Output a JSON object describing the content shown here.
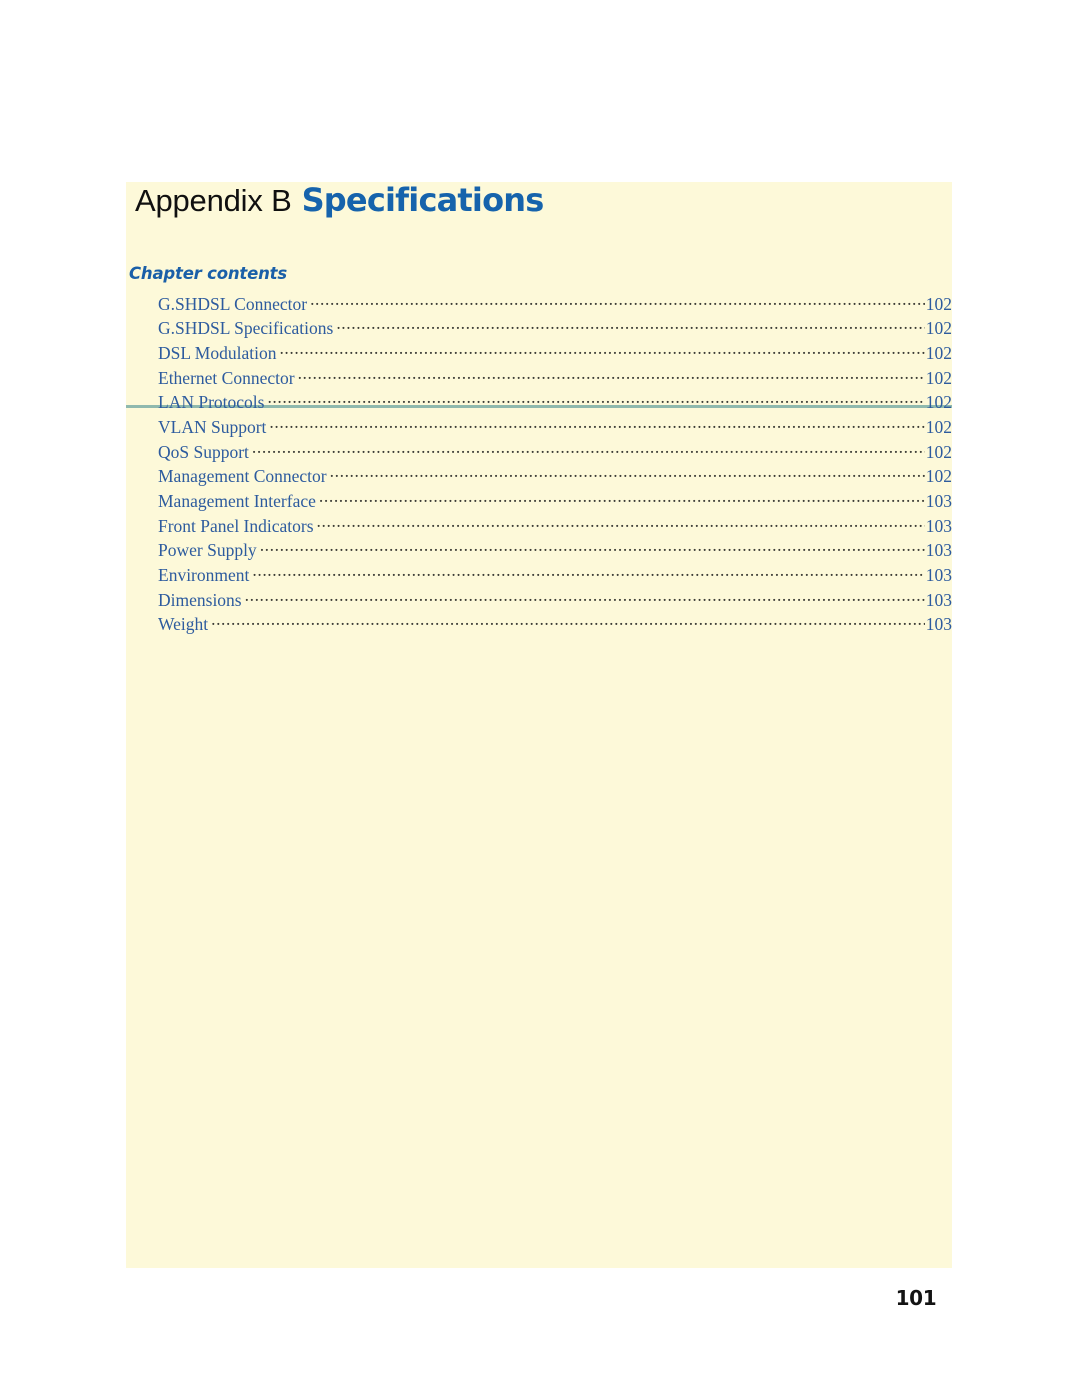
{
  "page": {
    "folio": "101",
    "background_color": "#ffffff",
    "panel_color": "#fdf9d9",
    "rule_color": "#8fb9ae",
    "accent_blue": "#1663ac",
    "toc_text_color": "#2d5b9e"
  },
  "header": {
    "appendix_label": "Appendix B",
    "chapter_name": "Specifications"
  },
  "contents": {
    "heading": "Chapter contents",
    "entries": [
      {
        "label": "G.SHDSL Connector",
        "page": "102"
      },
      {
        "label": "G.SHDSL Specifications",
        "page": "102"
      },
      {
        "label": "DSL Modulation",
        "page": "102"
      },
      {
        "label": "Ethernet Connector",
        "page": "102"
      },
      {
        "label": "LAN Protocols",
        "page": "102"
      },
      {
        "label": "VLAN Support",
        "page": "102"
      },
      {
        "label": "QoS Support",
        "page": "102"
      },
      {
        "label": "Management Connector",
        "page": "102"
      },
      {
        "label": "Management Interface",
        "page": "103"
      },
      {
        "label": "Front Panel Indicators",
        "page": "103"
      },
      {
        "label": "Power Supply",
        "page": "103"
      },
      {
        "label": "Environment",
        "page": "103"
      },
      {
        "label": "Dimensions",
        "page": "103"
      },
      {
        "label": "Weight",
        "page": "103"
      }
    ]
  }
}
